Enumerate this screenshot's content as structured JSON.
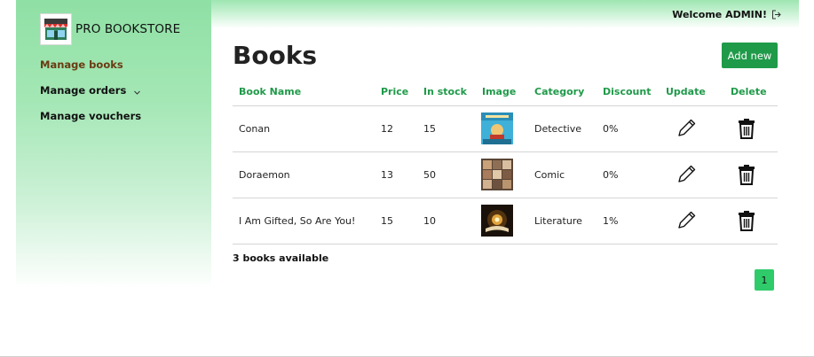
{
  "brand": {
    "name": "PRO BOOKSTORE",
    "logo_icon": "store-icon"
  },
  "sidebar": {
    "items": [
      {
        "label": "Manage books",
        "active": true
      },
      {
        "label": "Manage orders",
        "has_dropdown": true
      },
      {
        "label": "Manage vouchers"
      }
    ]
  },
  "topbar": {
    "welcome": "Welcome ADMIN!",
    "logout_icon": "logout-icon"
  },
  "main": {
    "title": "Books",
    "add_button": "Add new",
    "columns": [
      "Book Name",
      "Price",
      "In stock",
      "Image",
      "Category",
      "Discount",
      "Update",
      "Delete"
    ],
    "rows": [
      {
        "name": "Conan",
        "price": "12",
        "stock": "15",
        "category": "Detective",
        "discount": "0%",
        "image_icon": "book-cover-conan"
      },
      {
        "name": "Doraemon",
        "price": "13",
        "stock": "50",
        "category": "Comic",
        "discount": "0%",
        "image_icon": "book-cover-doraemon"
      },
      {
        "name": "I Am Gifted, So Are You!",
        "price": "15",
        "stock": "10",
        "category": "Literature",
        "discount": "1%",
        "image_icon": "book-cover-gifted"
      }
    ],
    "count_text": "3 books available",
    "pagination": {
      "current": "1"
    }
  },
  "colors": {
    "accent": "#1f9a49",
    "header_text": "#1f9a49",
    "active_nav": "#6b3a12",
    "pager": "#2fcb6a"
  }
}
